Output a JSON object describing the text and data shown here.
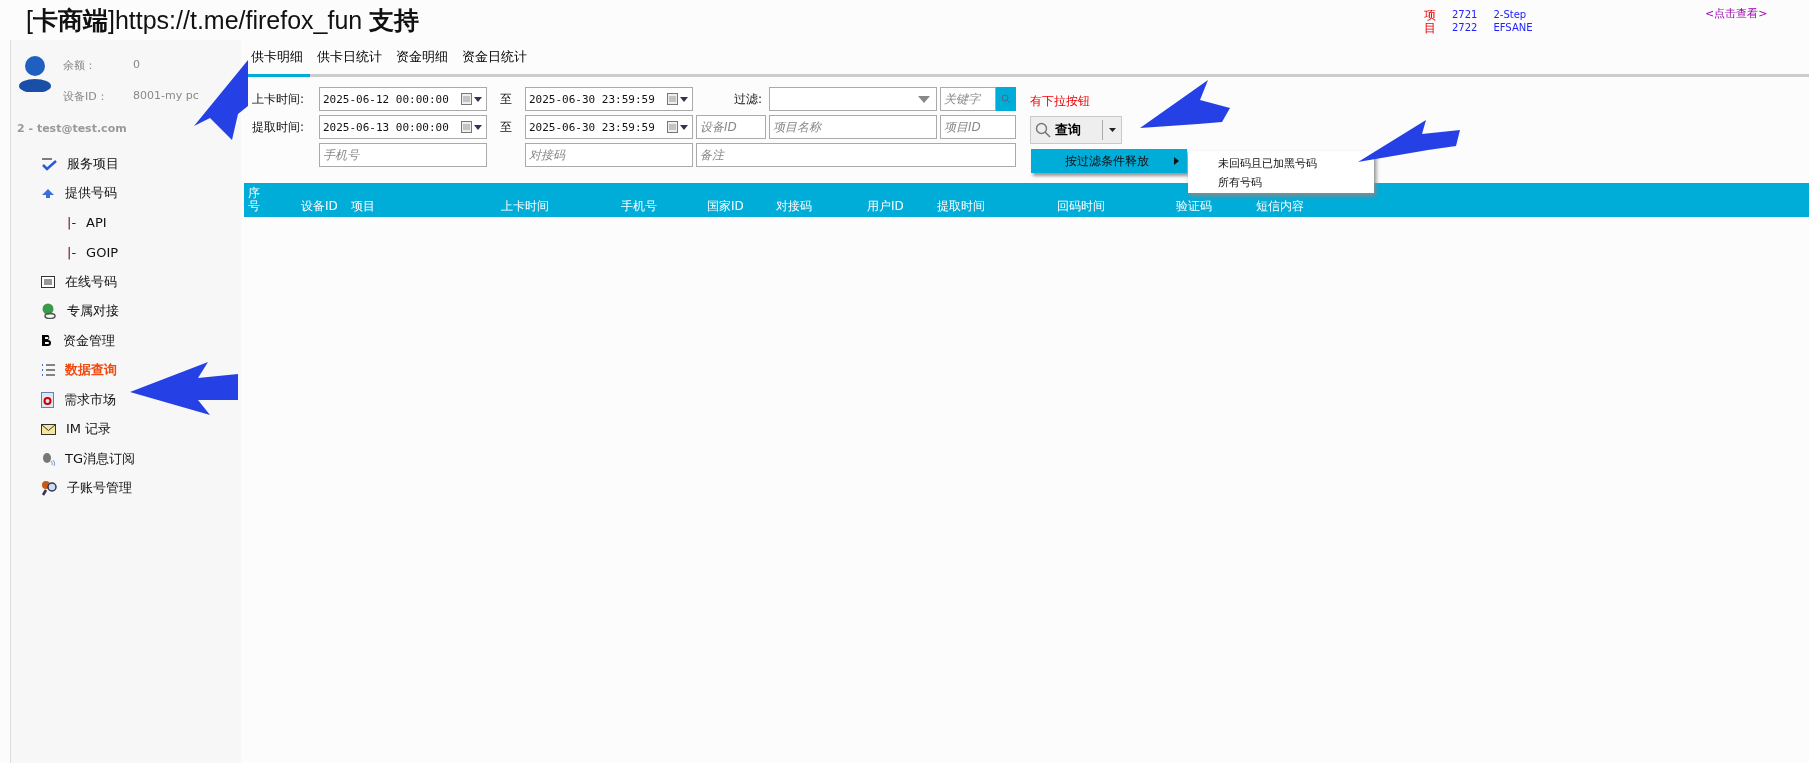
{
  "title": "[**卡商端**]https://t.me/firefox_fun **支持**",
  "notice": {
    "vertical_label": "项目",
    "items": [
      {
        "code": "2721",
        "name": "2-Step"
      },
      {
        "code": "2722",
        "name": "EFSANE"
      }
    ],
    "link": "<点击查看>"
  },
  "account": {
    "balance_label": "余额：",
    "balance": "0",
    "device_label": "设备ID：",
    "device": "8001-my pc",
    "user": "2  -  test@test.com"
  },
  "sidebar": {
    "items": [
      {
        "label": "服务项目",
        "selected": false
      },
      {
        "label": "提供号码",
        "selected": false,
        "children": [
          {
            "prefix": "|-",
            "label": "API",
            "selected": false
          },
          {
            "prefix": "|-",
            "label": "GOIP",
            "selected": false
          }
        ]
      },
      {
        "label": "在线号码",
        "selected": false
      },
      {
        "label": "专属对接",
        "selected": false
      },
      {
        "label": "资金管理",
        "selected": false
      },
      {
        "label": "数据查询",
        "selected": true
      },
      {
        "label": "需求市场",
        "selected": false
      },
      {
        "label": "IM 记录",
        "selected": false
      },
      {
        "label": "TG消息订阅",
        "selected": false
      },
      {
        "label": "子账号管理",
        "selected": false
      }
    ]
  },
  "tabs": [
    {
      "label": "供卡明细",
      "selected": true
    },
    {
      "label": "供卡日统计",
      "selected": false
    },
    {
      "label": "资金明细",
      "selected": false
    },
    {
      "label": "资金日统计",
      "selected": false
    }
  ],
  "filters": {
    "upload_label": "上卡时间:",
    "upload_from": "2025-06-12 00:00:00",
    "upload_to": "2025-06-30 23:59:59",
    "to_label": "至",
    "filter_label": "过滤:",
    "keyword_placeholder": "关键字",
    "fetch_label": "提取时间:",
    "fetch_from": "2025-06-13 00:00:00",
    "fetch_to": "2025-06-30 23:59:59",
    "to_label_2": "至",
    "device_placeholder": "设备ID",
    "project_name_placeholder": "项目名称",
    "project_id_placeholder": "项目ID",
    "phone_placeholder": "手机号",
    "code_placeholder": "对接码",
    "note_placeholder": "备注"
  },
  "query": {
    "hint": "有下拉按钮",
    "button": "查询",
    "menu_item": "按过滤条件释放",
    "submenu": [
      "未回码且已加黑号码",
      "所有号码"
    ]
  },
  "table": {
    "columns": [
      "序号",
      "设备ID",
      "项目",
      "上卡时间",
      "手机号",
      "国家ID",
      "对接码",
      "用户ID",
      "提取时间",
      "回码时间",
      "验证码",
      "短信内容"
    ]
  }
}
